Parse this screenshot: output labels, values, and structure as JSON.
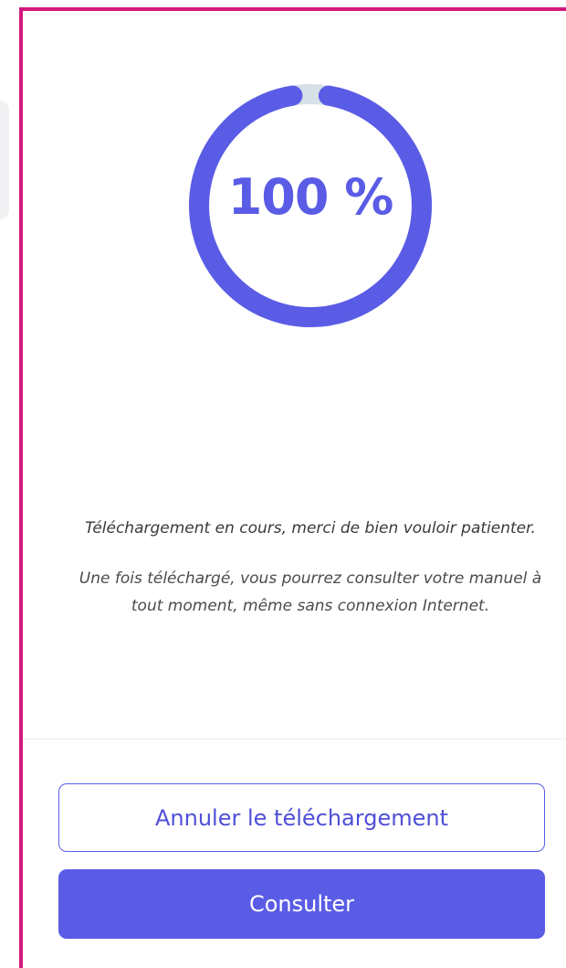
{
  "progress": {
    "label": "100 %",
    "value_percent": 100,
    "track_color": "#d7e0e6",
    "fill_color": "#5a5ce6"
  },
  "messages": {
    "downloading": "Téléchargement en cours, merci de bien vouloir patienter.",
    "offline_info": "Une fois téléchargé, vous pourrez consulter votre manuel à tout moment, même sans connexion Internet."
  },
  "actions": {
    "cancel_label": "Annuler le téléchargement",
    "consult_label": "Consulter"
  },
  "colors": {
    "frame_accent": "#d0197a",
    "primary": "#5a5ce6",
    "primary_text": "#ffffff"
  }
}
